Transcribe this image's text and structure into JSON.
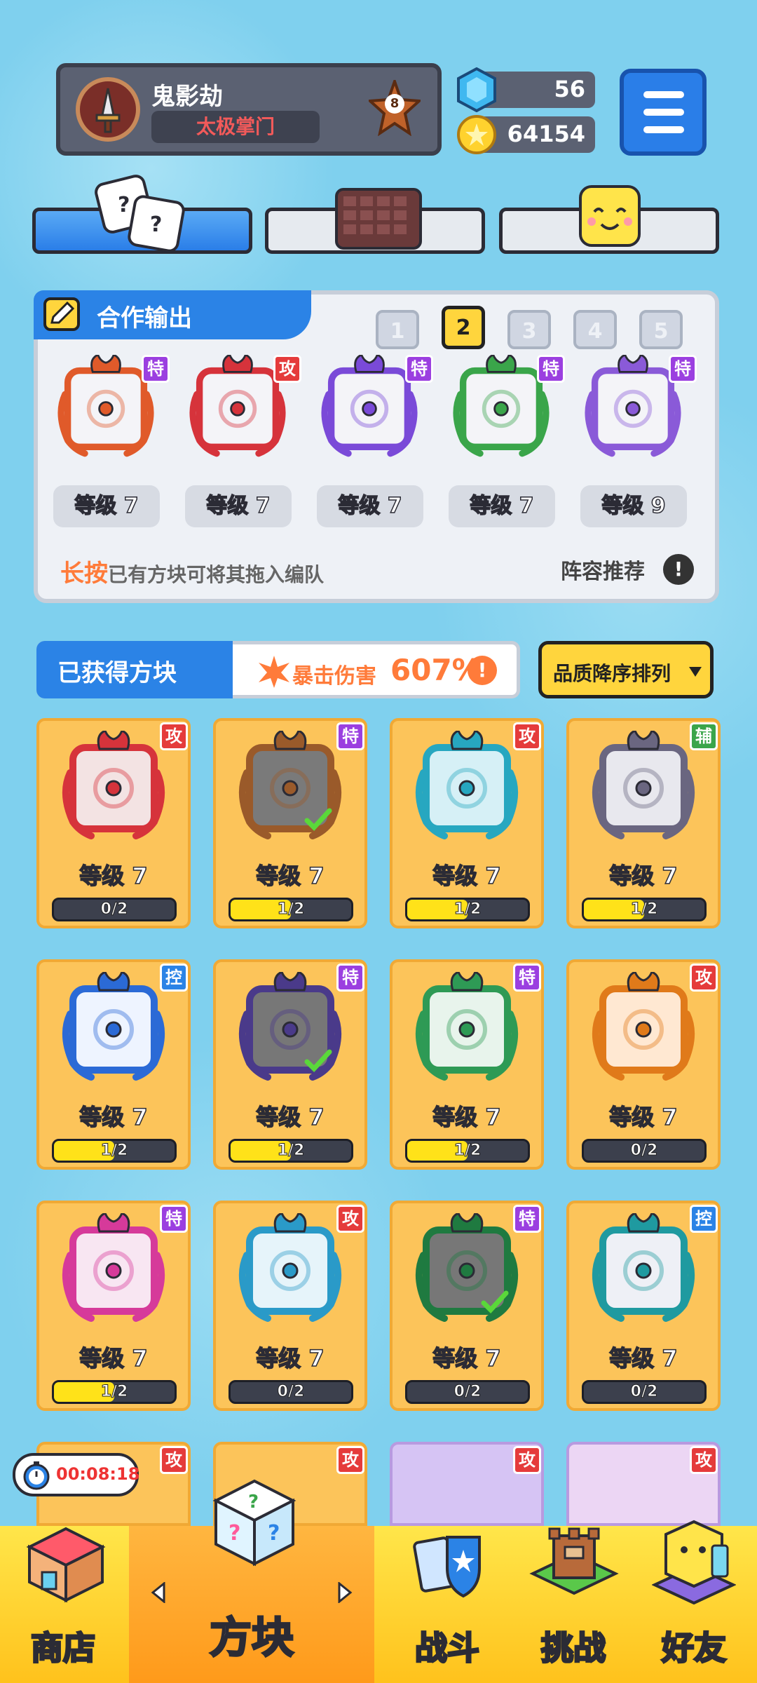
{
  "header": {
    "player_name": "鬼影劫",
    "player_title": "太极掌门",
    "rank_level": "8",
    "gems": "56",
    "coins": "64154"
  },
  "team": {
    "title": "合作输出",
    "slots": [
      "1",
      "2",
      "3",
      "4",
      "5"
    ],
    "active_slot": "2",
    "cards": [
      {
        "badge": "特",
        "badge_color": "#9b3fe0",
        "level": "等级 7",
        "frame": "#e05a2a",
        "inner": "rainbow-infinity"
      },
      {
        "badge": "攻",
        "badge_color": "#e53b3b",
        "level": "等级 7",
        "frame": "#d6333b",
        "inner": "saw-blade"
      },
      {
        "badge": "特",
        "badge_color": "#9b3fe0",
        "level": "等级 7",
        "frame": "#7a4ad8",
        "inner": "vortex"
      },
      {
        "badge": "特",
        "badge_color": "#9b3fe0",
        "level": "等级 7",
        "frame": "#3aa54a",
        "inner": "vine"
      },
      {
        "badge": "特",
        "badge_color": "#9b3fe0",
        "level": "等级 9",
        "frame": "#8a5ad8",
        "inner": "crack"
      }
    ],
    "hint_key": "长按",
    "hint_rest": "已有方块可将其拖入编队",
    "recommend": "阵容推荐",
    "recommend_icon": "!"
  },
  "owned": {
    "title": "已获得方块",
    "crit_label": "暴击伤害",
    "crit_value": "607%",
    "crit_icon": "!",
    "sort_label": "品质降序排列"
  },
  "cards": [
    {
      "badge": "攻",
      "badge_color": "#e53b3b",
      "level": "等级 7",
      "progress": "0/2",
      "fill": 0,
      "frame": "#d6333b",
      "bg": "#f3e3e3",
      "checked": false
    },
    {
      "badge": "特",
      "badge_color": "#9b3fe0",
      "level": "等级 7",
      "progress": "1/2",
      "fill": 0.5,
      "frame": "#9a5a2a",
      "bg": "#7a7a7a",
      "checked": true
    },
    {
      "badge": "攻",
      "badge_color": "#e53b3b",
      "level": "等级 7",
      "progress": "1/2",
      "fill": 0.5,
      "frame": "#27a7c0",
      "bg": "#d6f0f6",
      "checked": false
    },
    {
      "badge": "辅",
      "badge_color": "#3aa54a",
      "level": "等级 7",
      "progress": "1/2",
      "fill": 0.5,
      "frame": "#6a6680",
      "bg": "#e8e8ee",
      "checked": false
    },
    {
      "badge": "控",
      "badge_color": "#2b83e6",
      "level": "等级 7",
      "progress": "1/2",
      "fill": 0.5,
      "frame": "#2b6ad6",
      "bg": "#eef4ff",
      "checked": false
    },
    {
      "badge": "特",
      "badge_color": "#9b3fe0",
      "level": "等级 7",
      "progress": "1/2",
      "fill": 0.5,
      "frame": "#4a3a8a",
      "bg": "#777777",
      "checked": true
    },
    {
      "badge": "特",
      "badge_color": "#9b3fe0",
      "level": "等级 7",
      "progress": "1/2",
      "fill": 0.5,
      "frame": "#2e9a55",
      "bg": "#e8f4ec",
      "checked": false
    },
    {
      "badge": "攻",
      "badge_color": "#e53b3b",
      "level": "等级 7",
      "progress": "0/2",
      "fill": 0,
      "frame": "#e07a1a",
      "bg": "#ffe8d2",
      "checked": false
    },
    {
      "badge": "特",
      "badge_color": "#9b3fe0",
      "level": "等级 7",
      "progress": "1/2",
      "fill": 0.5,
      "frame": "#d63a9a",
      "bg": "#f8e6f2",
      "checked": false
    },
    {
      "badge": "攻",
      "badge_color": "#e53b3b",
      "level": "等级 7",
      "progress": "0/2",
      "fill": 0,
      "frame": "#2a9ac8",
      "bg": "#e6f4fa",
      "checked": false
    },
    {
      "badge": "特",
      "badge_color": "#9b3fe0",
      "level": "等级 7",
      "progress": "0/2",
      "fill": 0,
      "frame": "#1f7a40",
      "bg": "#777777",
      "checked": true
    },
    {
      "badge": "控",
      "badge_color": "#2b83e6",
      "level": "等级 7",
      "progress": "0/2",
      "fill": 0,
      "frame": "#1f9aa0",
      "bg": "#eef0f6",
      "checked": false
    }
  ],
  "partial_row": [
    {
      "badge": "攻",
      "badge_color": "#e53b3b"
    },
    {
      "badge": "攻",
      "badge_color": "#e53b3b"
    },
    {
      "badge": "攻",
      "badge_color": "#e53b3b"
    },
    {
      "badge": "攻",
      "badge_color": "#e53b3b"
    }
  ],
  "timer": "00:08:18",
  "nav": {
    "shop": "商店",
    "blocks": "方块",
    "battle": "战斗",
    "challenge": "挑战",
    "friends": "好友"
  }
}
